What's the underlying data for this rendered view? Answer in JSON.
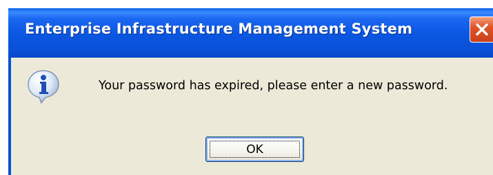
{
  "window": {
    "title": "Enterprise Infrastructure Management System",
    "close_icon": "close-icon"
  },
  "dialog": {
    "icon": "info-icon",
    "message": "Your password has expired, please enter a new password.",
    "ok_label": "OK"
  },
  "colors": {
    "titlebar": "#0a56e0",
    "client_background": "#ece9d8",
    "close_button": "#e0542a"
  }
}
